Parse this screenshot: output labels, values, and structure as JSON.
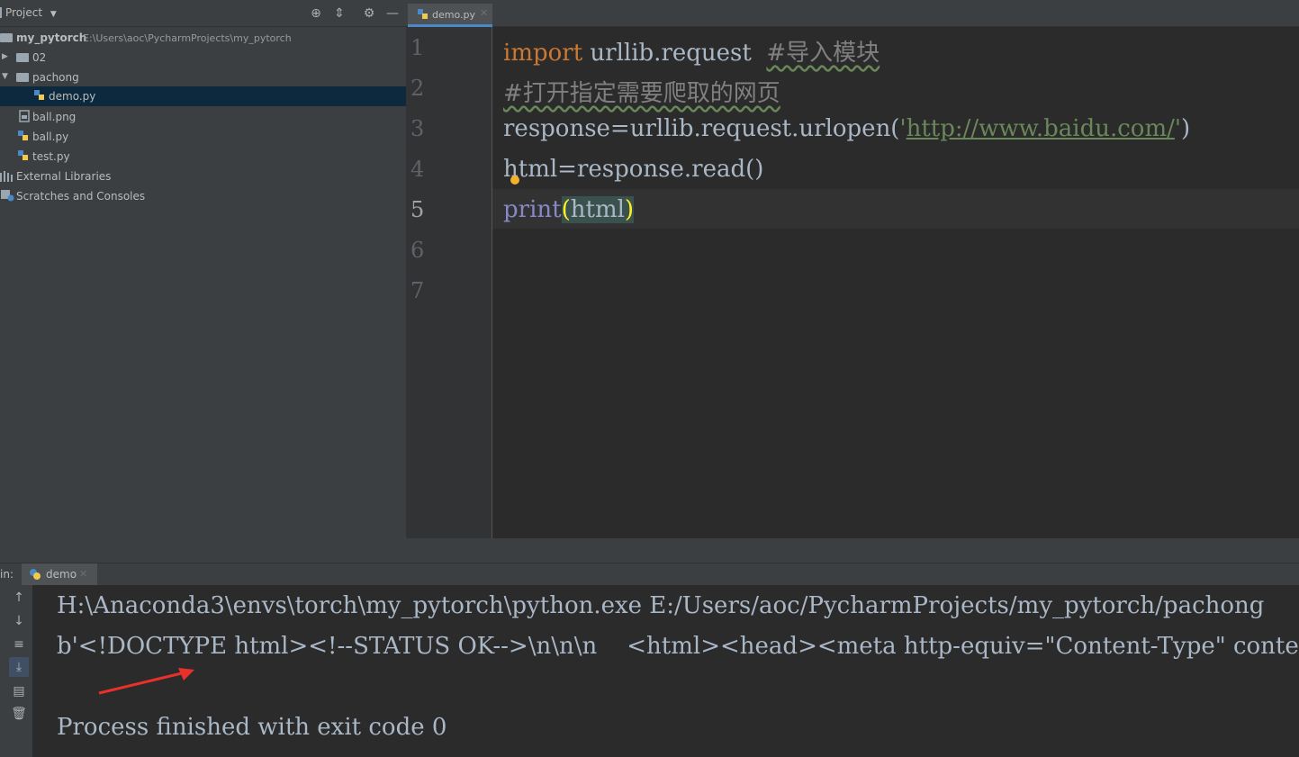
{
  "project": {
    "title": "Project",
    "tree": [
      {
        "label": "my_pytorch",
        "path": "E:\\Users\\aoc\\PycharmProjects\\my_pytorch"
      },
      {
        "label": "02"
      },
      {
        "label": "pachong"
      },
      {
        "label": "demo.py"
      },
      {
        "label": "ball.png"
      },
      {
        "label": "ball.py"
      },
      {
        "label": "test.py"
      },
      {
        "label": "External Libraries"
      },
      {
        "label": "Scratches and Consoles"
      }
    ]
  },
  "editor": {
    "tab_label": "demo.py",
    "line_numbers": [
      "1",
      "2",
      "3",
      "4",
      "5",
      "6",
      "7"
    ],
    "code": {
      "l1_kw": "import",
      "l1_mod": " urllib.request  ",
      "l1_comment": "#导入模块",
      "l2_comment": "#打开指定需要爬取的网页",
      "l3_pre": "response=urllib.request.urlopen(",
      "l3_q1": "'",
      "l3_url": "http://www.baidu.com/",
      "l3_q2": "'",
      "l3_post": ")",
      "l4": "html=response.read()",
      "l5_builtin": "print",
      "l5_open": "(",
      "l5_arg": "html",
      "l5_close": ")"
    }
  },
  "run": {
    "label": "in:",
    "tab_label": "demo",
    "output": [
      "H:\\Anaconda3\\envs\\torch\\my_pytorch\\python.exe E:/Users/aoc/PycharmProjects/my_pytorch/pachong",
      "b'<!DOCTYPE html><!--STATUS OK-->\\n\\n\\n    <html><head><meta http-equiv=\"Content-Type\" content",
      "",
      "Process finished with exit code 0"
    ]
  }
}
